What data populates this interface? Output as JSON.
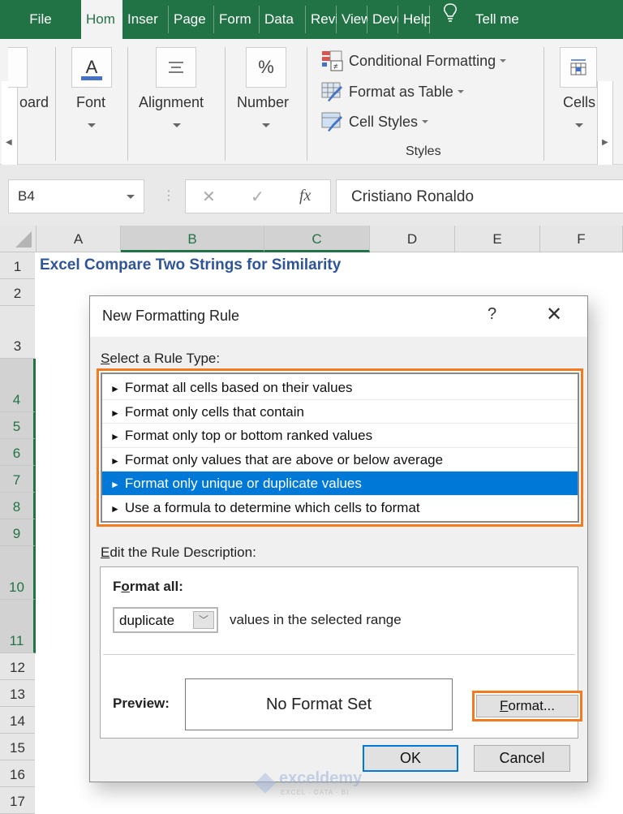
{
  "tabs": [
    {
      "label": "File"
    },
    {
      "label": "Hom",
      "active": true
    },
    {
      "label": "Inser"
    },
    {
      "label": "Page"
    },
    {
      "label": "Form"
    },
    {
      "label": "Data"
    },
    {
      "label": "Revie"
    },
    {
      "label": "View"
    },
    {
      "label": "Deve"
    },
    {
      "label": "Help"
    },
    {
      "label": "Tell me"
    }
  ],
  "ribbon": {
    "clipboard_label": "oard",
    "font_label": "Font",
    "alignment_label": "Alignment",
    "number_label": "Number",
    "number_icon": "%",
    "font_icon": "A",
    "styles": {
      "conditional_formatting": "Conditional Formatting",
      "format_as_table": "Format as Table",
      "cell_styles": "Cell Styles",
      "group_label": "Styles"
    },
    "cells_label": "Cells"
  },
  "formula_bar": {
    "name_box": "B4",
    "fx": "fx",
    "cancel_glyph": "✕",
    "enter_glyph": "✓",
    "value": "Cristiano Ronaldo"
  },
  "grid": {
    "columns": [
      "A",
      "B",
      "C",
      "D",
      "E",
      "F"
    ],
    "selected_columns": [
      "B",
      "C"
    ],
    "rows": [
      "1",
      "2",
      "3",
      "4",
      "5",
      "6",
      "7",
      "8",
      "9",
      "10",
      "11",
      "12",
      "13",
      "14",
      "15",
      "16",
      "17"
    ],
    "selected_rows": [
      "4",
      "5",
      "6",
      "7",
      "8",
      "9",
      "10",
      "11"
    ],
    "title_cell": "Excel Compare Two Strings for Similarity"
  },
  "dialog": {
    "title": "New Formatting Rule",
    "help": "?",
    "close": "✕",
    "select_rule_label_u": "S",
    "select_rule_label_rest": "elect a Rule Type:",
    "rule_types": [
      {
        "label": "Format all cells based on their values"
      },
      {
        "label": "Format only cells that contain"
      },
      {
        "label": "Format only top or bottom ranked values"
      },
      {
        "label": "Format only values that are above or below average"
      },
      {
        "label": "Format only unique or duplicate values",
        "selected": true
      },
      {
        "label": "Use a formula to determine which cells to format"
      }
    ],
    "edit_rule_label_u": "E",
    "edit_rule_label_rest": "dit the Rule Description:",
    "format_all_f": "F",
    "format_all_u": "o",
    "format_all_rest": "rmat all:",
    "combo_value": "duplicate",
    "combo_suffix": "values in the selected range",
    "preview_label": "Preview:",
    "preview_text": "No Format Set",
    "format_button_u": "F",
    "format_button_rest": "ormat...",
    "ok": "OK",
    "cancel": "Cancel"
  },
  "watermark": {
    "name": "exceldemy",
    "tagline": "EXCEL · DATA · BI"
  },
  "colors": {
    "excel_green": "#217346",
    "highlight_orange": "#f47a20",
    "selection_blue": "#0078d7",
    "title_blue": "#2f5597"
  }
}
